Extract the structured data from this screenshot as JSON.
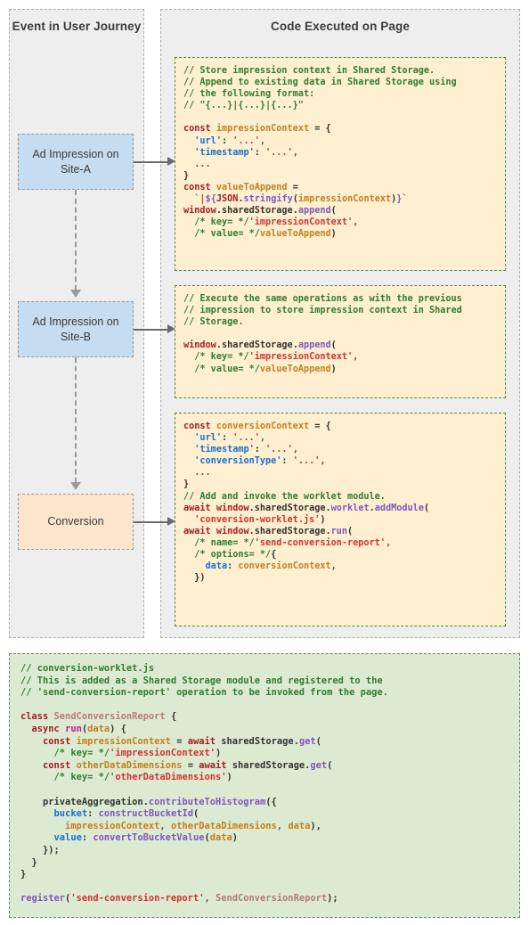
{
  "left_panel": {
    "title": "Event in User Journey",
    "boxes": [
      {
        "label": "Ad Impression on Site-A",
        "color": "#c6dcf0"
      },
      {
        "label": "Ad Impression on Site-B",
        "color": "#c6dcf0"
      },
      {
        "label": "Conversion",
        "color": "#fbe5cd"
      }
    ]
  },
  "right_panel": {
    "title": "Code Executed on Page",
    "code_blocks": [
      {
        "name": "impression-site-a-code"
      },
      {
        "name": "impression-site-b-code"
      },
      {
        "name": "conversion-code"
      }
    ]
  },
  "code": {
    "block0_lines": [
      "// Store impression context in Shared Storage.",
      "// Append to existing data in Shared Storage using",
      "// the following format:",
      "// \"{...}|{...}|{...}\"",
      "",
      "const impressionContext = {",
      "  'url': '...',",
      "  'timestamp': '...',",
      "  ...",
      "}",
      "const valueToAppend =",
      "  `|${JSON.stringify(impressionContext)}`",
      "window.sharedStorage.append(",
      "  /* key= */'impressionContext',",
      "  /* value= */valueToAppend)"
    ],
    "block1_lines": [
      "// Execute the same operations as with the previous",
      "// impression to store impression context in Shared",
      "// Storage.",
      "",
      "window.sharedStorage.append(",
      "  /* key= */'impressionContext',",
      "  /* value= */valueToAppend)"
    ],
    "block2_lines": [
      "const conversionContext = {",
      "  'url': '...',",
      "  'timestamp': '...',",
      "  'conversionType': '...',",
      "  ...",
      "}",
      "// Add and invoke the worklet module.",
      "await window.sharedStorage.worklet.addModule(",
      "  'conversion-worklet.js')",
      "await window.sharedStorage.run(",
      "  /* name= */'send-conversion-report',",
      "  /* options= */{",
      "    data: conversionContext,",
      "  })"
    ],
    "worklet_lines": [
      "// conversion-worklet.js",
      "// This is added as a Shared Storage module and registered to the",
      "// 'send-conversion-report' operation to be invoked from the page.",
      "",
      "class SendConversionReport {",
      "  async run(data) {",
      "    const impressionContext = await sharedStorage.get(",
      "      /* key= */'impressionContext')",
      "    const otherDataDimensions = await sharedStorage.get(",
      "      /* key= */'otherDataDimensions')",
      "",
      "    privateAggregation.contributeToHistogram({",
      "      bucket: constructBucketId(",
      "        impressionContext, otherDataDimensions, data),",
      "      value: convertToBucketValue(data)",
      "    });",
      "  }",
      "}",
      "",
      "register('send-conversion-report', SendConversionReport);"
    ]
  },
  "colors": {
    "panel_background": "#eeeeee",
    "code_background": "#fdefd0",
    "code_border": "#4f8a3a",
    "worklet_background": "#dcead1",
    "box_blue": "#c6dcf0",
    "box_peach": "#fbe5cd",
    "arrow": "#6b6b6b",
    "comment": "#2e7d32",
    "keyword": "#a61d24",
    "string": "#d1332e",
    "function": "#7e57c2",
    "variable": "#c47f1e"
  }
}
